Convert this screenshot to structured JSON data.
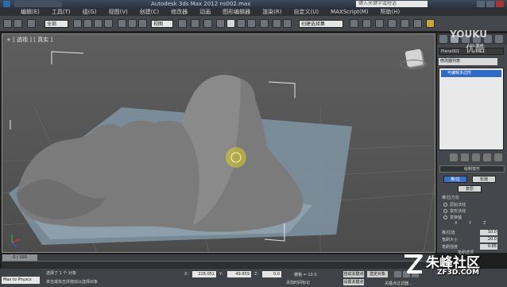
{
  "window": {
    "title": "Autodesk 3ds Max  2012    ns002.max",
    "search_placeholder": "键入关键字或短语"
  },
  "menu": [
    "编辑(E)",
    "工具(T)",
    "组(G)",
    "视图(V)",
    "创建(C)",
    "修改器",
    "动画",
    "图形编辑器",
    "渲染(R)",
    "自定义(U)",
    "MAXScript(M)",
    "帮助(H)"
  ],
  "toolbar": {
    "selection_filter": "全部",
    "ref_coord": "视图",
    "named_selection": "创建选择集"
  },
  "viewport": {
    "label": "+ [ 透视 ] [ 真实 ]"
  },
  "command_panel": {
    "object_name": "Plane001",
    "modifier_list": "修改器列表",
    "stack_item": "可编辑多边形",
    "rollout_soft": "绘制变形",
    "btn_push": "推/拉",
    "btn_relax": "松弛",
    "btn_revert": "复原",
    "push_direction": "推/拉方向",
    "radio_original": "原始法线",
    "radio_deformed": "变形法线",
    "radio_transform": "变换轴",
    "axis_x": "X",
    "axis_y": "Y",
    "axis_z": "Z",
    "push_value_label": "推/拉值",
    "push_value": "10.0",
    "brush_size_label": "笔刷大小",
    "brush_size": "20.0",
    "brush_strength_label": "笔刷强度",
    "brush_strength": "0.85",
    "brush_options": "笔刷选项"
  },
  "timeline": {
    "frame": "0 / 100"
  },
  "status": {
    "input": "Max to Physcs",
    "selected": "选择了 1 个 对象",
    "hint": "单击或单击并拖动以选择对象",
    "x_label": "X:",
    "x_value": "228.051",
    "y_label": "Y:",
    "y_value": "49.659",
    "z_label": "Z:",
    "z_value": "0.0",
    "grid": "栅格 = 10.0",
    "add_time_tag": "添加时间标记",
    "auto_key": "自动关键点",
    "selected_obj": "选定对象",
    "set_key": "设置关键点",
    "key_filter": "关键点过滤器..."
  },
  "watermarks": {
    "youku_en": "YOUKU",
    "youku_cn": "优酷",
    "site_name": "朱峰社区",
    "site_url": "ZF3D.COM"
  },
  "colors": {
    "selection_blue": "#2f6ac4",
    "brush_yellow": "#d8cf2a",
    "mountain": "#8a8a8a",
    "water": "#7f95a3"
  }
}
